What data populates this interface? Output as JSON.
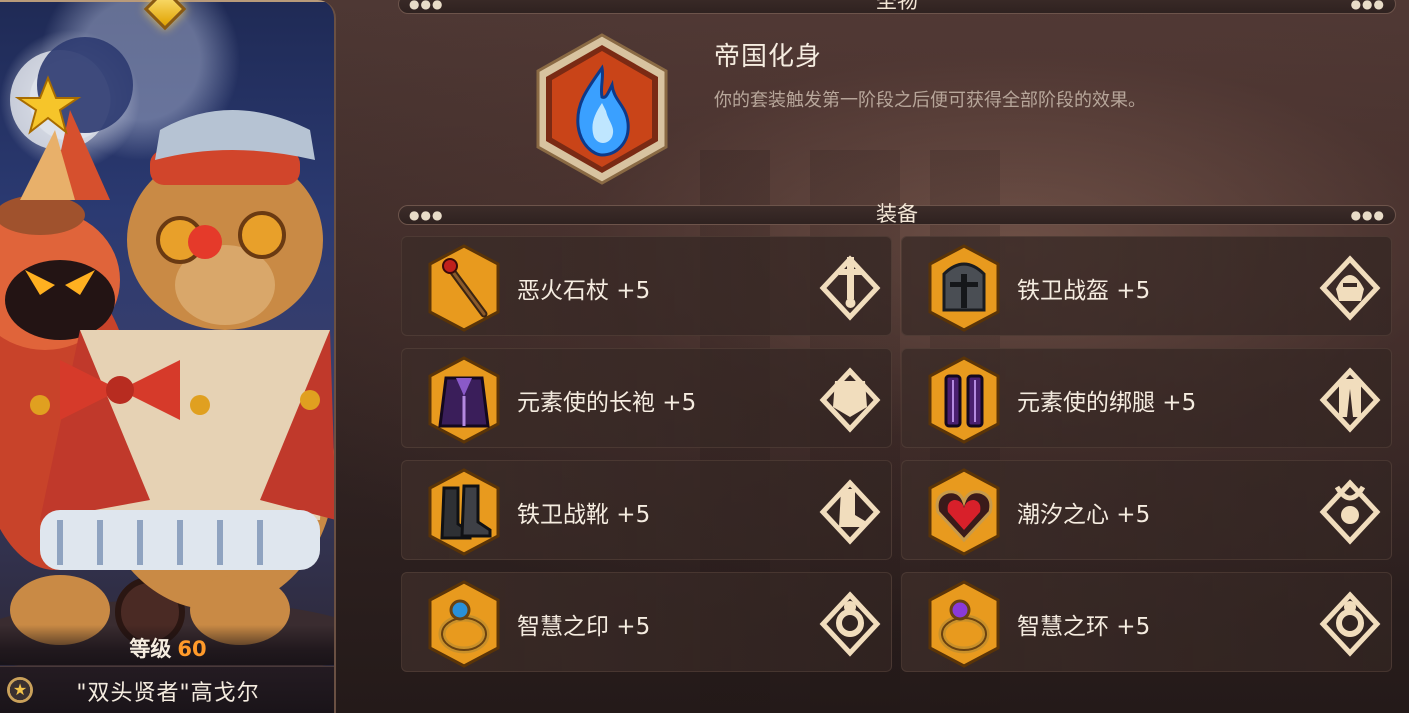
{
  "hero": {
    "level_label": "等级",
    "level_value": "60",
    "name": "\"双头贤者\"高戈尔",
    "badge_icon": "star-icon"
  },
  "relic_section": {
    "title": "圣物",
    "relic_name": "帝国化身",
    "relic_desc": "你的套装触发第一阶段之后便可获得全部阶段的效果。",
    "emblem_icon": "blue-flame-icon"
  },
  "equipment_section": {
    "title": "装备",
    "items": [
      {
        "name": "恶火石杖 +5",
        "icon": "staff-icon",
        "slot_icon": "weapon-slot-icon"
      },
      {
        "name": "铁卫战盔 +5",
        "icon": "helmet-icon",
        "slot_icon": "helmet-slot-icon"
      },
      {
        "name": "元素使的长袍 +5",
        "icon": "robe-icon",
        "slot_icon": "armor-slot-icon"
      },
      {
        "name": "元素使的绑腿 +5",
        "icon": "leggings-icon",
        "slot_icon": "legs-slot-icon"
      },
      {
        "name": "铁卫战靴 +5",
        "icon": "boots-icon",
        "slot_icon": "boots-slot-icon"
      },
      {
        "name": "潮汐之心 +5",
        "icon": "heart-amulet-icon",
        "slot_icon": "necklace-slot-icon"
      },
      {
        "name": "智慧之印 +5",
        "icon": "ring-blue-icon",
        "slot_icon": "ring-slot-icon"
      },
      {
        "name": "智慧之环 +5",
        "icon": "ring-purple-icon",
        "slot_icon": "ring-slot-icon"
      }
    ]
  },
  "colors": {
    "item_frame": "#e89a1e",
    "level_accent": "#ff9a2a",
    "slot_icon_cream": "#f1ddbd"
  }
}
